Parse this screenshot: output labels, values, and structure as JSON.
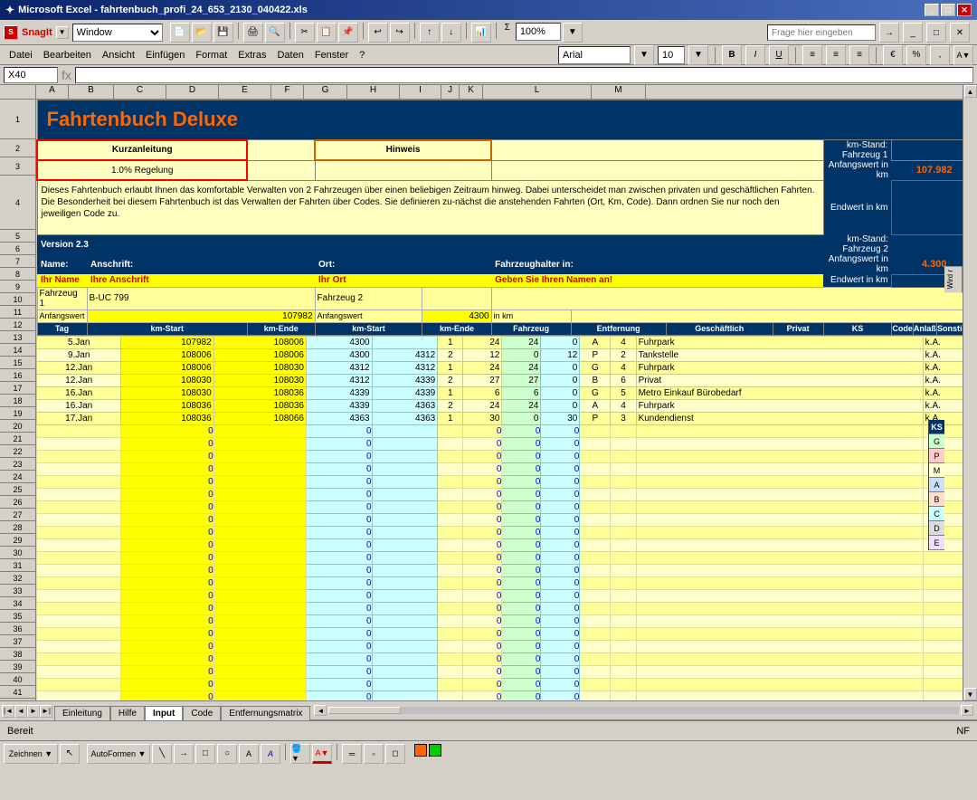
{
  "titlebar": {
    "text": "Microsoft Excel - fahrtenbuch_profi_24_653_2130_040422.xls",
    "controls": [
      "_",
      "□",
      "✕"
    ]
  },
  "menubar": {
    "items": [
      "Datei",
      "Bearbeiten",
      "Ansicht",
      "Einfügen",
      "Format",
      "Extras",
      "Daten",
      "Fenster",
      "?"
    ]
  },
  "snagbar": {
    "label": "SnagIt",
    "window_label": "Window",
    "help_placeholder": "Frage hier eingeben"
  },
  "formula_bar": {
    "cell_ref": "X40",
    "formula": ""
  },
  "sheet_title": "Fahrtenbuch Deluxe",
  "info_buttons": {
    "kurzanleitung": "Kurzanleitung",
    "regelung": "1.0% Regelung",
    "hinweis": "Hinweis"
  },
  "info_text": "Dieses Fahrtenbuch erlaubt Ihnen das komfortable Verwalten von 2 Fahrzeugen über einen beliebigen Zeitraum hinweg. Dabei unterscheidet man zwischen privaten und geschäftlichen Fahrten. Die Besonderheit bei diesem Fahrtenbuch ist das Verwalten der Fahrten über Codes. Sie definieren zu-nächst die anstehenden Fahrten (Ort, Km, Code). Dann ordnen Sie nur noch den jeweiligen Code zu.",
  "km_fields": {
    "fz1_label": "km-Stand: Fahrzeug 1",
    "anfangswert1_label": "Anfangswert in km",
    "anfangswert1_value": "107.982",
    "endwert1_label": "Endwert in km",
    "fz2_label": "km-Stand: Fahrzeug 2",
    "anfangswert2_label": "Anfangswert in km",
    "anfangswert2_value": "4.300",
    "endwert2_label": "Endwert in km"
  },
  "version": "Version 2.3",
  "header_fields": {
    "name_label": "Name:",
    "anschrift_label": "Anschrift:",
    "ort_label": "Ort:",
    "fahrzeughalter_label": "Fahrzeughalter in:",
    "name_value": "Ihr Name",
    "anschrift_value": "Ihre Anschrift",
    "ort_value": "Ihr Ort",
    "fahrzeughalter_value": "Geben Sie Ihren Namen an!"
  },
  "vehicles": {
    "fz1_name": "Fahrzeug 1",
    "fz1_start": "B-UC 799",
    "fz1_anfang_label": "Anfangswert",
    "fz1_anfang_value": "107982",
    "fz2_name": "Fahrzeug 2",
    "fz2_anfang_label": "Anfangswert",
    "fz2_anfang_value": "4300",
    "km_unit": "in km"
  },
  "table_headers": {
    "tag": "Tag",
    "km_start": "km-Start",
    "km_end": "km-Ende",
    "km_start2": "km-Start",
    "km_end2": "km-Ende",
    "fahrzeug": "Fahrzeug",
    "entfernung": "Entfernung",
    "geschaeftlich": "Geschäftlich",
    "privat": "Privat",
    "ks": "KS",
    "code": "Code",
    "anlass": "Anlaß",
    "sonstiges": "Sonstiges"
  },
  "data_rows": [
    {
      "tag": "5.Jan",
      "km_start": "107982",
      "km_end": "108006",
      "km_start2": "4300",
      "km_end2": "",
      "fahrzeug": "1",
      "entfernung": "24",
      "geschaeftlich": "24",
      "privat": "0",
      "ks": "A",
      "code": "4",
      "anlass": "Fuhrpark",
      "sonstiges": "k.A."
    },
    {
      "tag": "9.Jan",
      "km_start": "108006",
      "km_end": "108006",
      "km_start2": "4300",
      "km_end2": "4312",
      "fahrzeug": "2",
      "entfernung": "12",
      "geschaeftlich": "0",
      "privat": "12",
      "ks": "P",
      "code": "2",
      "anlass": "Tankstelle",
      "sonstiges": "k.A."
    },
    {
      "tag": "12.Jan",
      "km_start": "108006",
      "km_end": "108030",
      "km_start2": "4312",
      "km_end2": "4312",
      "fahrzeug": "1",
      "entfernung": "24",
      "geschaeftlich": "24",
      "privat": "0",
      "ks": "G",
      "code": "4",
      "anlass": "Fuhrpark",
      "sonstiges": "k.A."
    },
    {
      "tag": "12.Jan",
      "km_start": "108030",
      "km_end": "108030",
      "km_start2": "4312",
      "km_end2": "4339",
      "fahrzeug": "2",
      "entfernung": "27",
      "geschaeftlich": "27",
      "privat": "0",
      "ks": "B",
      "code": "6",
      "anlass": "Privat",
      "sonstiges": "k.A."
    },
    {
      "tag": "16.Jan",
      "km_start": "108030",
      "km_end": "108036",
      "km_start2": "4339",
      "km_end2": "4339",
      "fahrzeug": "1",
      "entfernung": "6",
      "geschaeftlich": "6",
      "privat": "0",
      "ks": "G",
      "code": "5",
      "anlass": "Metro Einkauf Bürobedarf",
      "sonstiges": "k.A."
    },
    {
      "tag": "16.Jan",
      "km_start": "108036",
      "km_end": "108036",
      "km_start2": "4339",
      "km_end2": "4363",
      "fahrzeug": "2",
      "entfernung": "24",
      "geschaeftlich": "24",
      "privat": "0",
      "ks": "A",
      "code": "4",
      "anlass": "Fuhrpark",
      "sonstiges": "k.A."
    },
    {
      "tag": "17.Jan",
      "km_start": "108036",
      "km_end": "108066",
      "km_start2": "4363",
      "km_end2": "4363",
      "fahrzeug": "1",
      "entfernung": "30",
      "geschaeftlich": "0",
      "privat": "30",
      "ks": "P",
      "code": "3",
      "anlass": "Kundendienst",
      "sonstiges": "k.A."
    }
  ],
  "empty_rows_count": 28,
  "ks_side_labels": [
    "KS",
    "G",
    "P",
    "M",
    "A",
    "B",
    "C",
    "D",
    "E"
  ],
  "wird_label": "Wird r",
  "sheet_tabs": [
    "Einleitung",
    "Hilfe",
    "Input",
    "Code",
    "Entfernungsmatrix"
  ],
  "active_tab": "Input",
  "status": "Bereit",
  "status_right": "NF",
  "zoom": "100%"
}
